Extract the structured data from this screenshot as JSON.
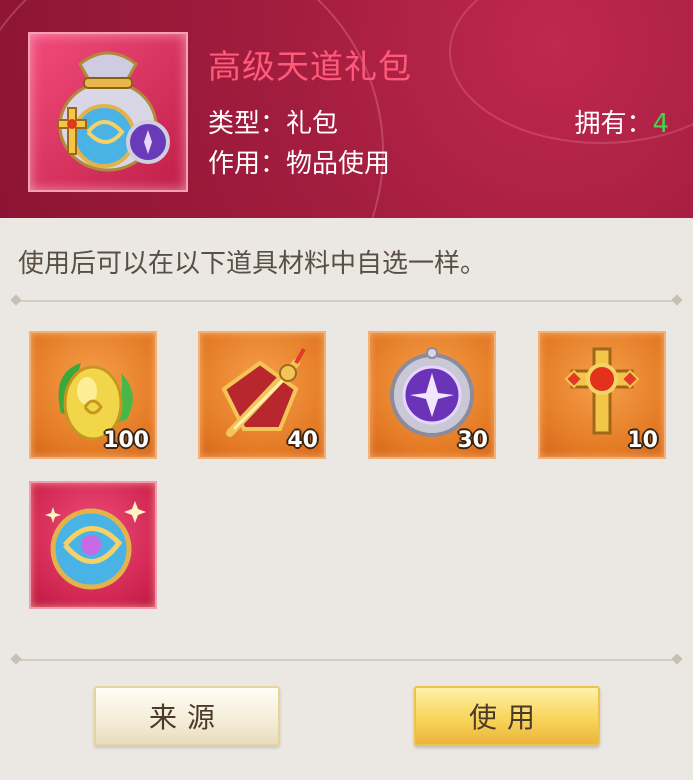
{
  "item": {
    "name": "高级天道礼包",
    "type_label": "类型：礼包",
    "use_label": "作用：物品使用",
    "owned_label": "拥有：",
    "owned_count": "4",
    "icon": "gift-bag-icon"
  },
  "description": "使用后可以在以下道具材料中自选一样。",
  "rewards": [
    {
      "icon": "golden-egg-icon",
      "qty": "100"
    },
    {
      "icon": "sword-emblem-icon",
      "qty": "40"
    },
    {
      "icon": "purple-orb-icon",
      "qty": "30"
    },
    {
      "icon": "golden-cross-icon",
      "qty": "10"
    },
    {
      "icon": "crystal-orb-icon",
      "qty": ""
    }
  ],
  "buttons": {
    "source": "来源",
    "use": "使用"
  },
  "colors": {
    "title": "#ff5a7a",
    "owned_count": "#3ed64a",
    "header": "#a31d3f"
  }
}
